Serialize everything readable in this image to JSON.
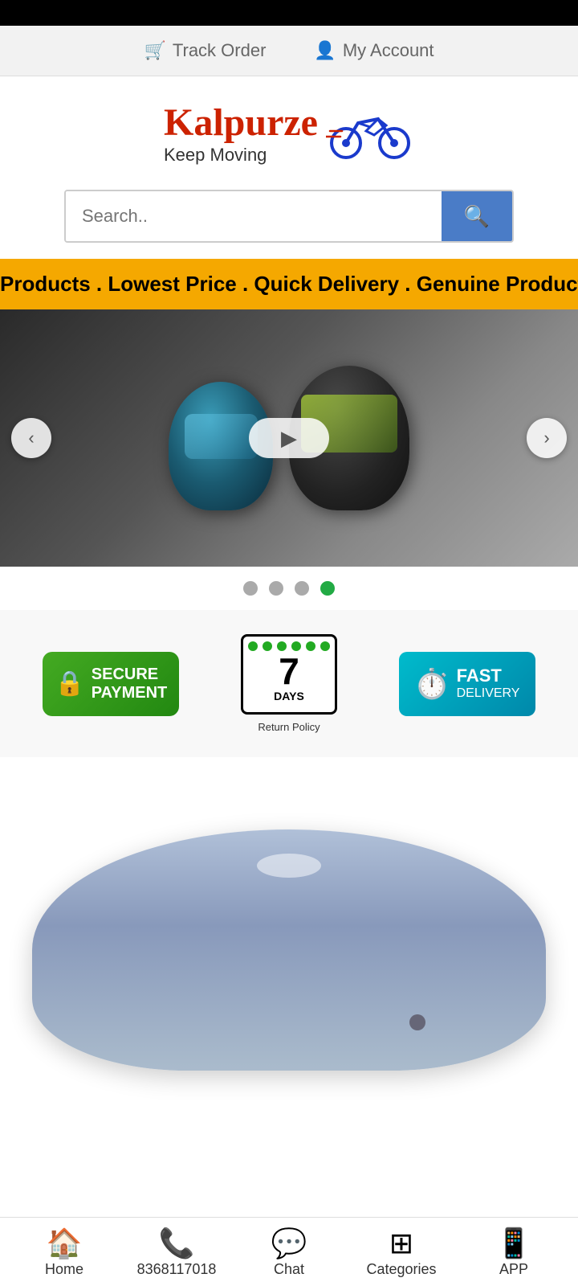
{
  "top_bar": {
    "track_order_label": "Track Order",
    "my_account_label": "My Account"
  },
  "logo": {
    "brand_name": "Kalpurze",
    "tagline": "Keep Moving"
  },
  "search": {
    "placeholder": "Search..",
    "button_label": "Search"
  },
  "marquee": {
    "text": "Products . Lowest Price . Quick Delivery . Genuine Products"
  },
  "carousel": {
    "dots": [
      {
        "active": false
      },
      {
        "active": false
      },
      {
        "active": false
      },
      {
        "active": true
      }
    ]
  },
  "trust_badges": {
    "secure_payment": "SECURE PAYMENT",
    "return_days": "7",
    "return_label": "DAYS",
    "return_policy": "Return Policy",
    "fast_label": "FAST",
    "fast_sub": "DELIVERY"
  },
  "bottom_nav": {
    "home_label": "Home",
    "phone_label": "8368117018",
    "chat_label": "Chat",
    "categories_label": "Categories",
    "app_label": "APP"
  }
}
